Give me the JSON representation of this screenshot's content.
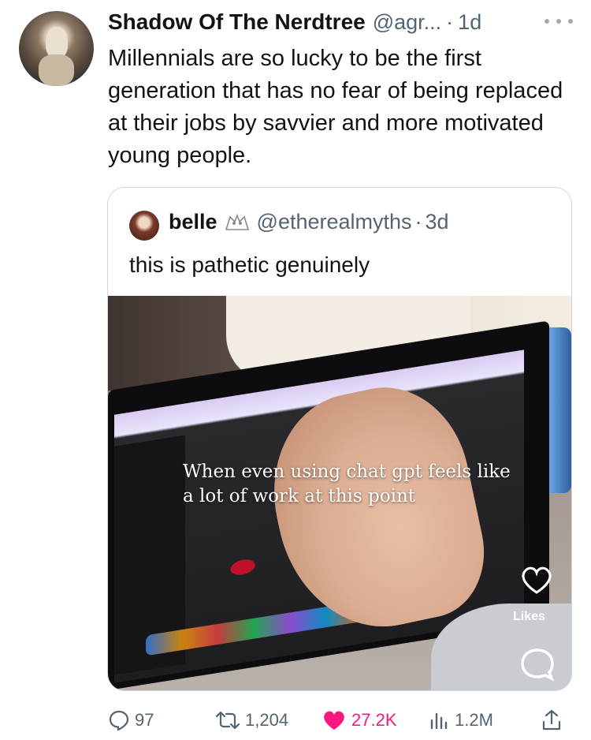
{
  "tweet": {
    "author_name": "Shadow Of The Nerdtree",
    "handle": "@agr...",
    "dot": "·",
    "time": "1d",
    "text": "Millennials are so lucky to be the first generation that has no fear of being replaced at their jobs by savvier and more motivated young people.",
    "more_icon": "more-horizontal-icon"
  },
  "quoted": {
    "name": "belle",
    "badge_icon": "owl-badge-icon",
    "handle": "@etherealmyths",
    "dot": "·",
    "time": "3d",
    "text": "this is pathetic genuinely",
    "media": {
      "caption": "When even using chat gpt feels like a lot of work at this point",
      "likes_label": "Likes"
    }
  },
  "actions": {
    "replies": "97",
    "retweets": "1,204",
    "likes": "27.2K",
    "views": "1.2M"
  },
  "colors": {
    "text": "#0f1419",
    "secondary": "#536471",
    "like": "#f91880",
    "border": "#cfd9de"
  }
}
